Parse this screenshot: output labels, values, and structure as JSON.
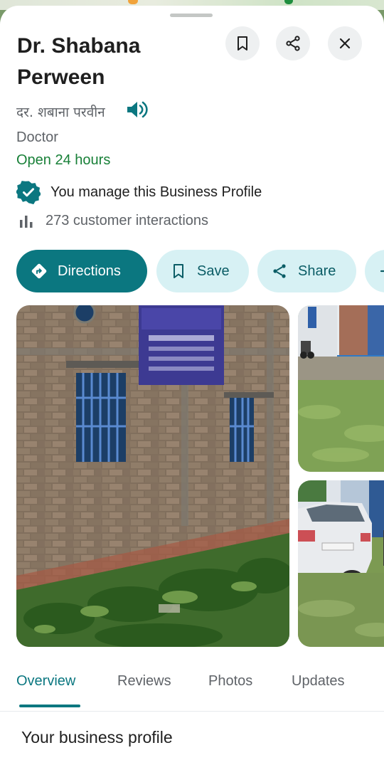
{
  "place": {
    "name": "Dr. Shabana Perween",
    "local_name": "दर. शबाना परवीन",
    "category": "Doctor",
    "hours_status": "Open 24 hours",
    "manage_text": "You manage this Business Profile",
    "interactions_text": "273 customer interactions"
  },
  "actions": {
    "directions": "Directions",
    "save": "Save",
    "share": "Share"
  },
  "tabs": [
    {
      "label": "Overview",
      "active": true
    },
    {
      "label": "Reviews",
      "active": false
    },
    {
      "label": "Photos",
      "active": false
    },
    {
      "label": "Updates",
      "active": false
    }
  ],
  "section": {
    "title": "Your business profile"
  },
  "colors": {
    "accent": "#0b7780",
    "chip_bg": "#d7f1f4",
    "open_green": "#188038"
  },
  "icons": [
    "bookmark-icon",
    "share-icon",
    "close-icon",
    "speaker-icon",
    "verified-icon",
    "bar-chart-icon",
    "directions-icon"
  ]
}
